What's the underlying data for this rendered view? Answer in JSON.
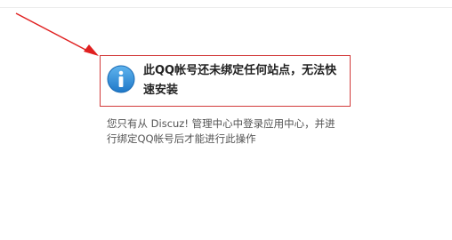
{
  "notice": {
    "title": "此QQ帐号还未绑定任何站点，无法快速安装",
    "description": "您只有从 Discuz! 管理中心中登录应用中心，并进行绑定QQ帐号后才能进行此操作",
    "icon": "info-icon",
    "border_color": "#d23a3a",
    "icon_color": "#2f8fd6"
  },
  "annotation": {
    "icon": "red-arrow",
    "color": "#e02020"
  }
}
